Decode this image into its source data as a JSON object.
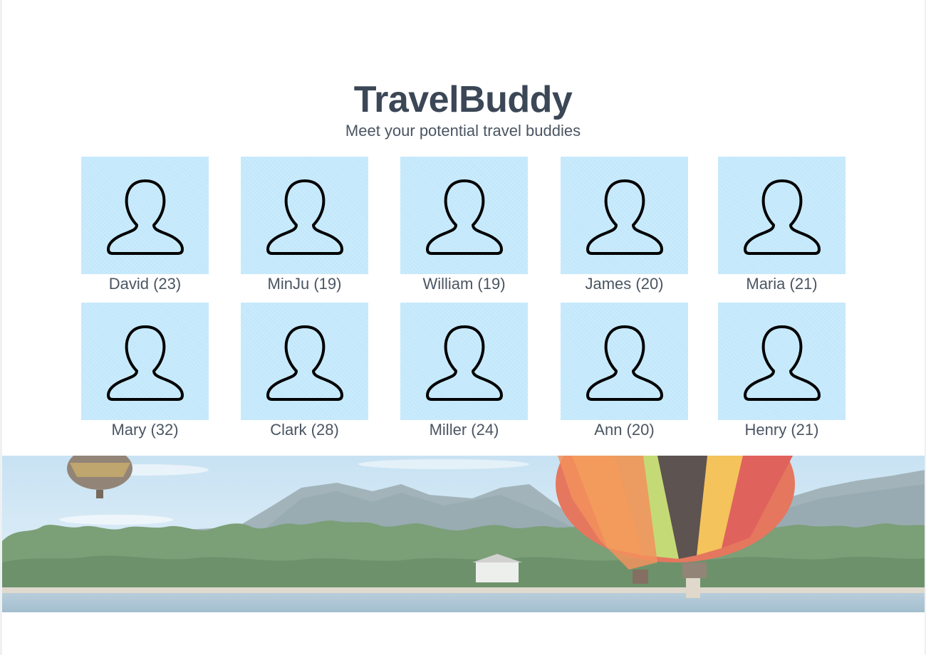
{
  "header": {
    "title": "TravelBuddy",
    "subtitle": "Meet your potential travel buddies"
  },
  "buddies": [
    {
      "label": "David (23)"
    },
    {
      "label": "MinJu (19)"
    },
    {
      "label": "William (19)"
    },
    {
      "label": "James (20)"
    },
    {
      "label": "Maria (21)"
    },
    {
      "label": "Mary (32)"
    },
    {
      "label": "Clark (28)"
    },
    {
      "label": "Miller (24)"
    },
    {
      "label": "Ann (20)"
    },
    {
      "label": "Henry (21)"
    }
  ],
  "icons": {
    "avatar": "user-silhouette-icon"
  },
  "colors": {
    "title": "#3b4756",
    "avatar_background": "#c3e8fb",
    "icon_stroke": "#000000"
  }
}
